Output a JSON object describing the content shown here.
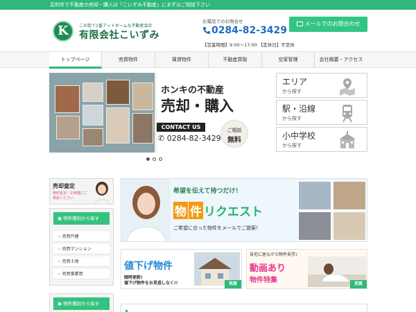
{
  "topbar": {
    "text": "足利市で不動産の売却・購入は「こいずみ不動産」にまずはご相談下さい"
  },
  "logo": {
    "mark": "K",
    "tagline": "この街で1番アットホームな不動産会社",
    "name": "有限会社こいずみ"
  },
  "contact": {
    "caption": "お電話でのお問合せ",
    "phone": "0284-82-3429",
    "hours": "【営業時間】9:00～17:00 【定休日】不定休",
    "mail_button": "メールでのお問合わせ"
  },
  "nav": {
    "items": [
      "トップページ",
      "売買物件",
      "賃貸物件",
      "不動産買取",
      "空家管理",
      "会社概要・アクセス"
    ]
  },
  "slider": {
    "headline1": "ホンキの不動産",
    "headline2": "売却・購入",
    "contact_label": "CONTACT US",
    "phone": "0284-82-3429",
    "consult_line1": "ご相談",
    "consult_line2": "無料"
  },
  "search": [
    {
      "title": "エリア",
      "sub": "から探す",
      "icon": "map-pin-icon"
    },
    {
      "title": "駅・沿線",
      "sub": "から探す",
      "icon": "train-icon"
    },
    {
      "title": "小中学校",
      "sub": "から探す",
      "icon": "school-icon"
    }
  ],
  "sell_banner": {
    "title": "売却査定",
    "sub": "無料査定！お気軽にご相談ください"
  },
  "side1": {
    "heading": "物件種別から探す",
    "links": [
      "売買戸建",
      "売買マンション",
      "売買土地",
      "売買事業用"
    ]
  },
  "side2": {
    "heading": "物件種別から探す"
  },
  "request": {
    "lead": "希望を伝えて待つだけ！",
    "title_box1": "物",
    "title_box2": "件",
    "title_rest": "リクエスト",
    "sub": "ご希望に合った物件をメールでご提案！"
  },
  "price_banner": {
    "title": "値下げ物件",
    "sub1": "随時更新!",
    "sub2": "値下げ物件をお見逃しなく!!",
    "tag": "売買"
  },
  "video_banner": {
    "top": "自宅に居ながら物件見学♪",
    "title": "動画あり",
    "sub": "物件特集",
    "tag": "売買"
  },
  "colors": {
    "accent": "#2eb87a",
    "phone": "#1f6ec2",
    "brand_dark": "#1f6e48"
  }
}
